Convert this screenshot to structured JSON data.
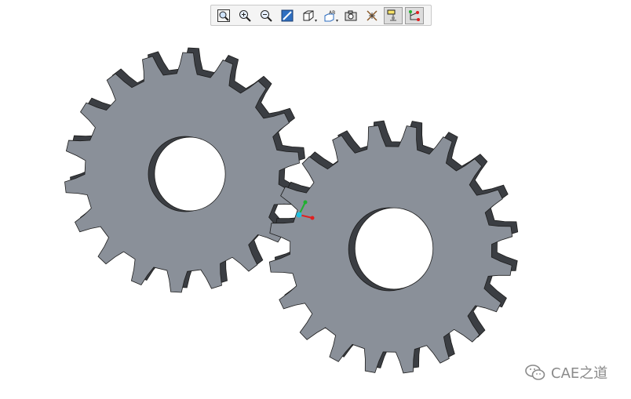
{
  "app": {
    "title": ""
  },
  "toolbar": {
    "buttons": [
      {
        "id": "zoom-fit",
        "icon": "zoom-fit-icon",
        "active": false
      },
      {
        "id": "zoom-in",
        "icon": "zoom-in-icon",
        "active": false
      },
      {
        "id": "zoom-out",
        "icon": "zoom-out-icon",
        "active": false
      },
      {
        "id": "repaint",
        "icon": "repaint-icon",
        "active": false
      },
      {
        "id": "display-style",
        "icon": "cube-icon",
        "active": false,
        "dropdown": true
      },
      {
        "id": "saved-views",
        "icon": "saved-views-icon",
        "active": false,
        "dropdown": true
      },
      {
        "id": "view-manager",
        "icon": "camera-icon",
        "active": false
      },
      {
        "id": "annotations",
        "icon": "axes-toggle-icon",
        "active": false
      },
      {
        "id": "datum-display",
        "icon": "datum-filter-icon",
        "active": true
      },
      {
        "id": "spin-center",
        "icon": "spin-center-icon",
        "active": true
      }
    ],
    "colors": {
      "bg": "#f4f4f4",
      "border": "#c9c9c9",
      "active": "#dcdcdc"
    }
  },
  "model": {
    "gears": [
      {
        "name": "left-gear",
        "teeth": 18
      },
      {
        "name": "right-gear",
        "teeth": 20
      }
    ],
    "colors": {
      "face": "#8a9099",
      "side": "#3b3e43",
      "edge": "#1c1c1c",
      "bore": "#ffffff"
    }
  },
  "triad": {
    "colors": {
      "x": "#e02020",
      "y": "#20b030",
      "z": "#20c0e0"
    }
  },
  "watermark": {
    "text": "CAE之道",
    "icon": "wechat-icon"
  }
}
